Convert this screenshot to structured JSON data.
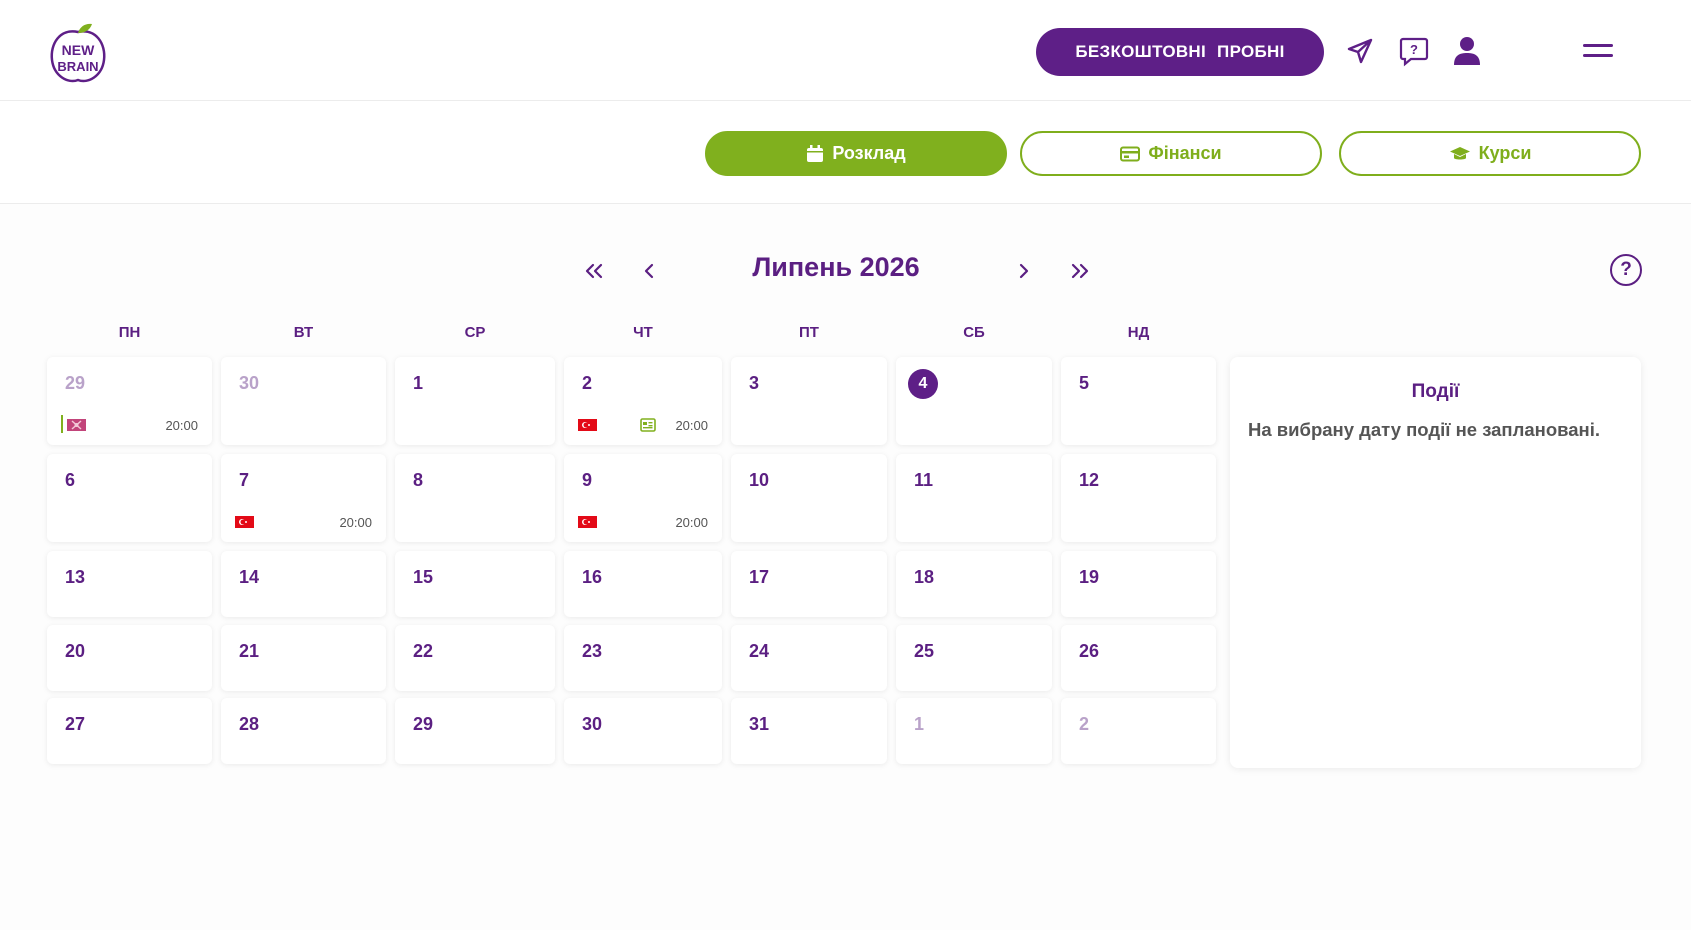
{
  "header": {
    "trial_button": "БЕЗКОШТОВНІ ПРОБНІ",
    "icons": [
      "logo-newbrain",
      "send-icon",
      "chat-question-icon",
      "user-icon",
      "menu-icon"
    ],
    "brand_color": "#5e1f87"
  },
  "tabs": [
    {
      "label": "Розклад",
      "icon": "calendar-icon",
      "active": true
    },
    {
      "label": "Фінанси",
      "icon": "card-icon",
      "active": false
    },
    {
      "label": "Курси",
      "icon": "graduation-cap-icon",
      "active": false
    }
  ],
  "accent_color": "#80b01e",
  "calendar": {
    "title": "Липень 2026",
    "help": "?",
    "weekdays": [
      "ПН",
      "ВТ",
      "СР",
      "ЧТ",
      "ПТ",
      "СБ",
      "НД"
    ],
    "weeks": [
      [
        {
          "day": "29",
          "muted": true,
          "events": [
            {
              "flag": "flag-other",
              "time": "20:00",
              "bar": true
            }
          ]
        },
        {
          "day": "30",
          "muted": true,
          "events": []
        },
        {
          "day": "1",
          "events": []
        },
        {
          "day": "2",
          "events": [
            {
              "flag": "flag-turkey",
              "extra": "card-icon",
              "time": "20:00"
            }
          ]
        },
        {
          "day": "3",
          "events": []
        },
        {
          "day": "4",
          "today": true,
          "events": []
        },
        {
          "day": "5",
          "events": []
        }
      ],
      [
        {
          "day": "6",
          "events": []
        },
        {
          "day": "7",
          "events": [
            {
              "flag": "flag-turkey",
              "time": "20:00"
            }
          ]
        },
        {
          "day": "8",
          "events": []
        },
        {
          "day": "9",
          "events": [
            {
              "flag": "flag-turkey",
              "time": "20:00"
            }
          ]
        },
        {
          "day": "10",
          "events": []
        },
        {
          "day": "11",
          "events": []
        },
        {
          "day": "12",
          "events": []
        }
      ],
      [
        {
          "day": "13",
          "events": []
        },
        {
          "day": "14",
          "events": []
        },
        {
          "day": "15",
          "events": []
        },
        {
          "day": "16",
          "events": []
        },
        {
          "day": "17",
          "events": []
        },
        {
          "day": "18",
          "events": []
        },
        {
          "day": "19",
          "events": []
        }
      ],
      [
        {
          "day": "20",
          "events": []
        },
        {
          "day": "21",
          "events": []
        },
        {
          "day": "22",
          "events": []
        },
        {
          "day": "23",
          "events": []
        },
        {
          "day": "24",
          "events": []
        },
        {
          "day": "25",
          "events": []
        },
        {
          "day": "26",
          "events": []
        }
      ],
      [
        {
          "day": "27",
          "events": []
        },
        {
          "day": "28",
          "events": []
        },
        {
          "day": "29",
          "events": []
        },
        {
          "day": "30",
          "events": []
        },
        {
          "day": "31",
          "events": []
        },
        {
          "day": "1",
          "muted": true,
          "events": []
        },
        {
          "day": "2",
          "muted": true,
          "events": []
        }
      ]
    ]
  },
  "events_panel": {
    "title": "Події",
    "empty_text": "На вибрану дату події не заплановані."
  }
}
